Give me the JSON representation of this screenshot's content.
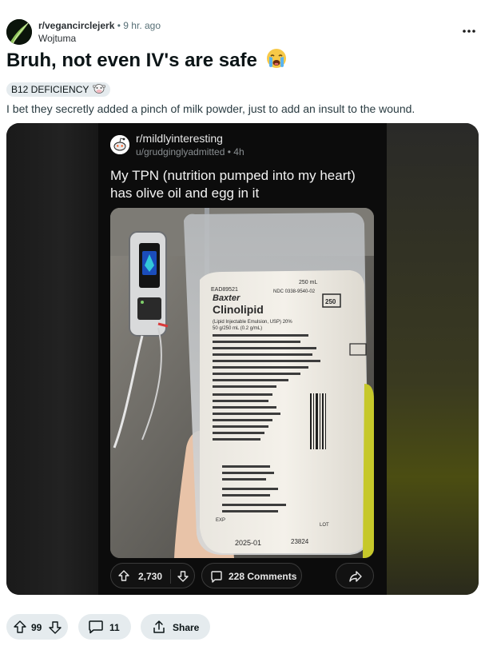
{
  "post": {
    "subreddit": "r/vegancirclejerk",
    "separator": "•",
    "age": "9 hr. ago",
    "author": "Wojtuma",
    "title": "Bruh, not even IV's are safe",
    "flair": "B12 DEFICIENCY",
    "body": "I bet they secretly added a pinch of milk powder, just to add an insult to the wound."
  },
  "embedded": {
    "subreddit": "r/mildlyinteresting",
    "user_line": "u/grudginglyadmitted • 4h",
    "title": "My TPN (nutrition pumped into my heart) has olive oil and egg in it",
    "upvotes": "2,730",
    "comments": "228 Comments",
    "bag_labels": {
      "brand": "Baxter",
      "product": "Clinolipid",
      "volume": "250 mL",
      "size_box": "250",
      "expiry": "2025-01",
      "ndc": "NDC 0338-9540-02",
      "lot_code": "EAD89521",
      "lot_number": "23824",
      "lot": "LOT",
      "exp": "EXP",
      "description": "(Lipid Injectable Emulsion, USP) 20%",
      "concentration": "50 g/250 mL (0.2 g/mL)"
    }
  },
  "actions": {
    "votes": "99",
    "comments": "11",
    "share": "Share"
  },
  "icons": {
    "title_emoji": "loudly-crying-face",
    "flair_emoji": "cow-face"
  },
  "colors": {
    "background": "#ffffff",
    "embedded_card": "#0c0c0c",
    "pill": "#e5ebee",
    "text": "#0b1416"
  }
}
